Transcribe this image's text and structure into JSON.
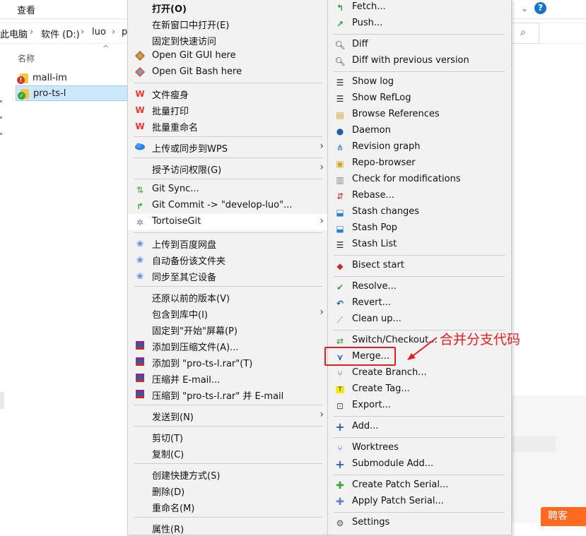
{
  "ribbon": {
    "view_tab": "查看"
  },
  "breadcrumb": [
    "此电脑",
    "软件 (D:)",
    "luo",
    "pr"
  ],
  "file_list": {
    "column_header": "名称",
    "files": [
      {
        "name": "mall-im",
        "status": "conflict"
      },
      {
        "name": "pro-ts-l",
        "status": "normal"
      }
    ]
  },
  "main_menu": {
    "items": [
      {
        "label": "打开(O)",
        "icon": "none",
        "bold": true
      },
      {
        "label": "在新窗口中打开(E)",
        "icon": "none"
      },
      {
        "label": "固定到快速访问",
        "icon": "none"
      },
      {
        "label": "Open Git GUI here",
        "icon": "git-gui-icon"
      },
      {
        "label": "Open Git Bash here",
        "icon": "git-bash-icon"
      },
      {
        "label": "文件瘦身",
        "icon": "wps-icon"
      },
      {
        "label": "批量打印",
        "icon": "wps-icon"
      },
      {
        "label": "批量重命名",
        "icon": "wps-icon"
      },
      {
        "label": "上传或同步到WPS",
        "icon": "cloud-icon",
        "submenu": true
      },
      {
        "label": "授予访问权限(G)",
        "icon": "none",
        "submenu": true
      },
      {
        "label": "Git Sync...",
        "icon": "git-sync-icon"
      },
      {
        "label": "Git Commit -> \"develop-luo\"...",
        "icon": "git-commit-icon"
      },
      {
        "label": "TortoiseGit",
        "icon": "tortoisegit-icon",
        "submenu": true,
        "highlighted": true
      },
      {
        "label": "上传到百度网盘",
        "icon": "baidu-icon"
      },
      {
        "label": "自动备份该文件夹",
        "icon": "baidu-icon"
      },
      {
        "label": "同步至其它设备",
        "icon": "baidu-icon"
      },
      {
        "label": "还原以前的版本(V)",
        "icon": "none"
      },
      {
        "label": "包含到库中(I)",
        "icon": "none",
        "submenu": true
      },
      {
        "label": "固定到\"开始\"屏幕(P)",
        "icon": "none"
      },
      {
        "label": "添加到压缩文件(A)...",
        "icon": "winrar-icon"
      },
      {
        "label": "添加到 \"pro-ts-l.rar\"(T)",
        "icon": "winrar-icon"
      },
      {
        "label": "压缩并 E-mail...",
        "icon": "winrar-icon"
      },
      {
        "label": "压缩到 \"pro-ts-l.rar\" 并 E-mail",
        "icon": "winrar-icon"
      },
      {
        "label": "发送到(N)",
        "icon": "none",
        "submenu": true
      },
      {
        "label": "剪切(T)",
        "icon": "none"
      },
      {
        "label": "复制(C)",
        "icon": "none"
      },
      {
        "label": "创建快捷方式(S)",
        "icon": "none"
      },
      {
        "label": "删除(D)",
        "icon": "none"
      },
      {
        "label": "重命名(M)",
        "icon": "none"
      },
      {
        "label": "属性(R)",
        "icon": "none"
      }
    ]
  },
  "tortoise_menu": {
    "items": [
      {
        "label": "Fetch...",
        "icon": "fetch-icon"
      },
      {
        "label": "Push...",
        "icon": "push-icon"
      },
      {
        "label": "Diff",
        "icon": "diff-icon"
      },
      {
        "label": "Diff with previous version",
        "icon": "diff-icon"
      },
      {
        "label": "Show log",
        "icon": "log-icon"
      },
      {
        "label": "Show RefLog",
        "icon": "log-icon"
      },
      {
        "label": "Browse References",
        "icon": "references-icon"
      },
      {
        "label": "Daemon",
        "icon": "daemon-icon"
      },
      {
        "label": "Revision graph",
        "icon": "revision-graph-icon"
      },
      {
        "label": "Repo-browser",
        "icon": "repo-browser-icon"
      },
      {
        "label": "Check for modifications",
        "icon": "check-modifications-icon"
      },
      {
        "label": "Rebase...",
        "icon": "rebase-icon"
      },
      {
        "label": "Stash changes",
        "icon": "stash-icon"
      },
      {
        "label": "Stash Pop",
        "icon": "stash-icon"
      },
      {
        "label": "Stash List",
        "icon": "log-icon"
      },
      {
        "label": "Bisect start",
        "icon": "bisect-icon"
      },
      {
        "label": "Resolve...",
        "icon": "resolve-icon"
      },
      {
        "label": "Revert...",
        "icon": "revert-icon"
      },
      {
        "label": "Clean up...",
        "icon": "cleanup-icon"
      },
      {
        "label": "Switch/Checkout...",
        "icon": "switch-icon"
      },
      {
        "label": "Merge...",
        "icon": "merge-icon"
      },
      {
        "label": "Create Branch...",
        "icon": "branch-icon"
      },
      {
        "label": "Create Tag...",
        "icon": "tag-icon"
      },
      {
        "label": "Export...",
        "icon": "export-icon"
      },
      {
        "label": "Add...",
        "icon": "add-icon"
      },
      {
        "label": "Worktrees",
        "icon": "worktree-icon"
      },
      {
        "label": "Submodule Add...",
        "icon": "add-icon"
      },
      {
        "label": "Create Patch Serial...",
        "icon": "patch-icon"
      },
      {
        "label": "Apply Patch Serial...",
        "icon": "apply-patch-icon"
      },
      {
        "label": "Settings",
        "icon": "settings-icon"
      }
    ]
  },
  "annotation": {
    "text": "合并分支代码"
  },
  "corner_button": {
    "label": "聘客"
  },
  "colors": {
    "highlight_red": "#e02020",
    "menu_bg": "#f2f2f2",
    "selection": "#cce8ff",
    "accent_orange": "#ff6a20"
  }
}
